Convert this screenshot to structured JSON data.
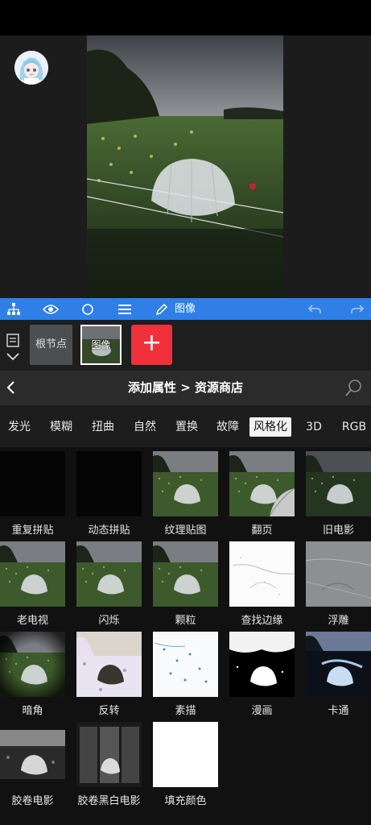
{
  "toolbar": {
    "current_node_label": "图像",
    "icons": [
      "hierarchy-icon",
      "eye-icon",
      "circle-icon",
      "menu-icon",
      "pencil-icon",
      "undo-icon",
      "redo-icon"
    ]
  },
  "nodes": {
    "root_label": "根节点",
    "image_label": "图像",
    "add_label": "+"
  },
  "header": {
    "title": "添加属性 > 资源商店"
  },
  "tabs": [
    {
      "label": "发光"
    },
    {
      "label": "模糊"
    },
    {
      "label": "扭曲"
    },
    {
      "label": "自然"
    },
    {
      "label": "置换"
    },
    {
      "label": "故障"
    },
    {
      "label": "风格化",
      "active": true
    },
    {
      "label": "3D"
    },
    {
      "label": "RGB"
    }
  ],
  "effects": [
    {
      "label": "重复拼贴",
      "style": "black"
    },
    {
      "label": "动态拼贴",
      "style": "black"
    },
    {
      "label": "纹理贴图",
      "style": "photo"
    },
    {
      "label": "翻页",
      "style": "pagecurl"
    },
    {
      "label": "旧电影",
      "style": "photo-dark"
    },
    {
      "label": "老电视",
      "style": "photo"
    },
    {
      "label": "闪烁",
      "style": "photo"
    },
    {
      "label": "颗粒",
      "style": "photo"
    },
    {
      "label": "查找边缘",
      "style": "edges"
    },
    {
      "label": "浮雕",
      "style": "emboss"
    },
    {
      "label": "暗角",
      "style": "vignette"
    },
    {
      "label": "反转",
      "style": "invert"
    },
    {
      "label": "素描",
      "style": "sketch"
    },
    {
      "label": "漫画",
      "style": "comic"
    },
    {
      "label": "卡通",
      "style": "cartoon"
    },
    {
      "label": "胶卷电影",
      "style": "film"
    },
    {
      "label": "胶卷黑白电影",
      "style": "filmbw"
    },
    {
      "label": "填充颜色",
      "style": "white"
    }
  ],
  "colors": {
    "toolbar_blue": "#2f7fe6",
    "add_red": "#f0313b"
  }
}
